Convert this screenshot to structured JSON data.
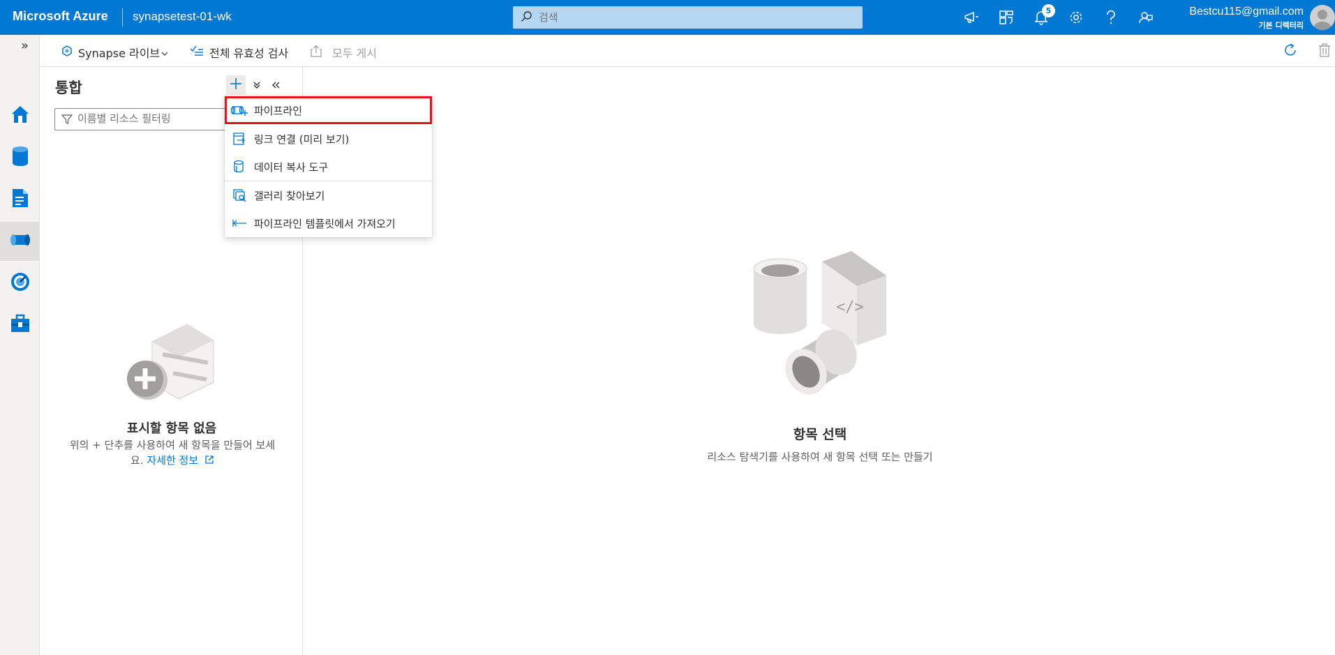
{
  "header": {
    "brand": "Microsoft Azure",
    "workspace": "synapsetest-01-wk",
    "search_placeholder": "검색",
    "notification_count": "5",
    "user_email": "Bestcu115@gmail.com",
    "user_directory": "기본 디렉터리",
    "icons": [
      "megaphone-icon",
      "portal-switch-icon",
      "bell-icon",
      "gear-icon",
      "help-icon",
      "feedback-icon"
    ]
  },
  "leftnav": {
    "items": [
      "home-icon",
      "data-icon",
      "develop-icon",
      "integrate-icon",
      "monitor-icon",
      "manage-icon"
    ],
    "active": "integrate-icon"
  },
  "toolbar": {
    "live_mode": "Synapse 라이브",
    "validate_all": "전체 유효성 검사",
    "publish_all": "모두 게시"
  },
  "panel": {
    "title": "통합",
    "filter_placeholder": "이름별 리소스 필터링",
    "empty_title": "표시할 항목 없음",
    "empty_text": "위의 + 단추를 사용하여 새 항목을 만들어 보세요.",
    "learn_more": "자세한 정보"
  },
  "dropdown": {
    "items": [
      {
        "label": "파이프라인",
        "icon": "pipeline-icon"
      },
      {
        "label": "링크 연결 (미리 보기)",
        "icon": "link-connection-icon"
      },
      {
        "label": "데이터 복사 도구",
        "icon": "copy-data-icon"
      },
      {
        "label": "갤러리 찾아보기",
        "icon": "gallery-icon"
      },
      {
        "label": "파이프라인 템플릿에서 가져오기",
        "icon": "import-template-icon"
      }
    ],
    "highlighted": "파이프라인",
    "highlight_color": "#e81123"
  },
  "main": {
    "title": "항목 선택",
    "subtitle": "리소스 탐색기를 사용하여 새 항목 선택 또는 만들기"
  },
  "colors": {
    "brand": "#0078d4",
    "highlight": "#e81123"
  }
}
